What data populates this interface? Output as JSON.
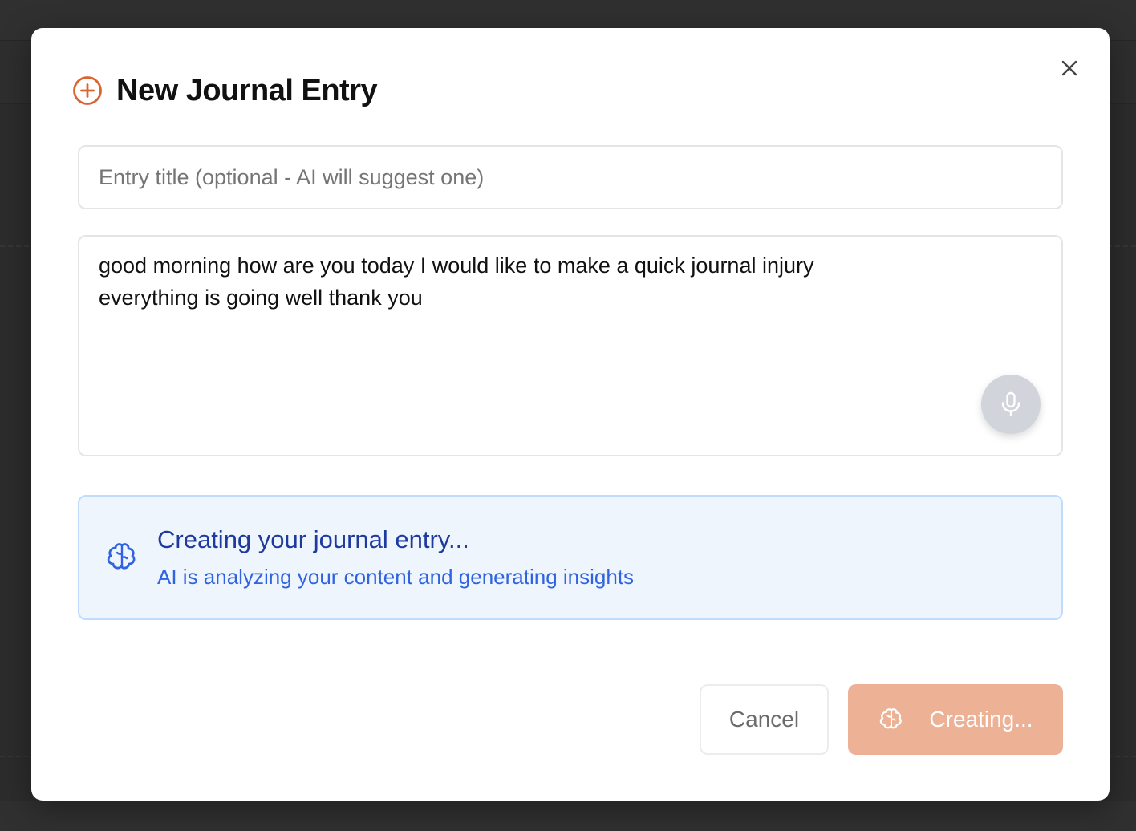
{
  "modal": {
    "title": "New Journal Entry",
    "title_icon": "plus-circle-icon",
    "close_icon": "close-icon"
  },
  "form": {
    "title_input": {
      "value": "",
      "placeholder": "Entry title (optional - AI will suggest one)"
    },
    "content": {
      "value": "good morning how are you today I would like to make a quick journal injury everything is going well thank you"
    },
    "mic_icon": "microphone-icon"
  },
  "status": {
    "icon": "brain-icon",
    "title": "Creating your journal entry...",
    "subtitle": "AI is analyzing your content and generating insights"
  },
  "actions": {
    "cancel_label": "Cancel",
    "create_label": "Creating...",
    "create_icon": "brain-icon"
  },
  "colors": {
    "accent": "#d9642f",
    "accent_disabled": "#edb196",
    "status_bg": "#eff5fd",
    "status_border": "#bfdbfe",
    "status_title": "#1e3a9f",
    "status_subtitle": "#2f63e0",
    "overlay": "#2c2c2c"
  }
}
